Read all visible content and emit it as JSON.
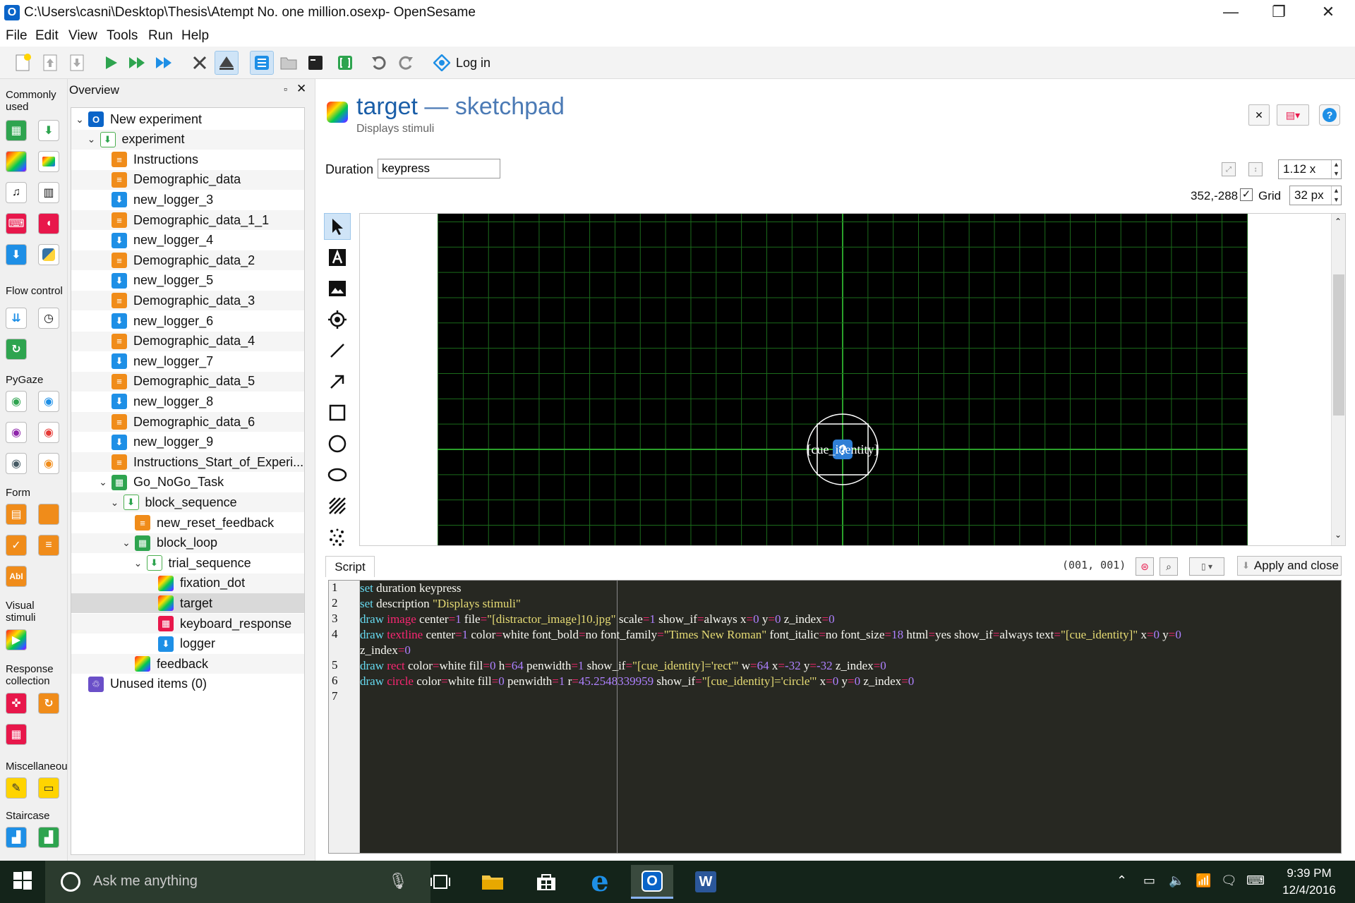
{
  "window": {
    "title": "C:\\Users\\casni\\Desktop\\Thesis\\Atempt No. one million.osexp- OpenSesame",
    "app_icon": "O",
    "minimize": "—",
    "maximize": "❐",
    "close": "✕"
  },
  "menu": [
    "File",
    "Edit",
    "View",
    "Tools",
    "Run",
    "Help"
  ],
  "toolbar": {
    "login_label": "Log in"
  },
  "palette": {
    "sections": [
      "Commonly used",
      "Flow control",
      "PyGaze",
      "Form",
      "Visual stimuli",
      "Response collection",
      "Miscellaneou",
      "Staircase"
    ]
  },
  "overview": {
    "title": "Overview",
    "float_icon": "▫",
    "close_icon": "✕",
    "items": [
      {
        "label": "New experiment",
        "level": 0,
        "icon": "exp",
        "chev": "⌄"
      },
      {
        "label": "experiment",
        "level": 1,
        "icon": "seq",
        "chev": "⌄"
      },
      {
        "label": "Instructions",
        "level": 2,
        "icon": "orange",
        "chev": ""
      },
      {
        "label": "Demographic_data",
        "level": 2,
        "icon": "orange",
        "chev": ""
      },
      {
        "label": "new_logger_3",
        "level": 2,
        "icon": "blue",
        "chev": ""
      },
      {
        "label": "Demographic_data_1_1",
        "level": 2,
        "icon": "orange",
        "chev": ""
      },
      {
        "label": "new_logger_4",
        "level": 2,
        "icon": "blue",
        "chev": ""
      },
      {
        "label": "Demographic_data_2",
        "level": 2,
        "icon": "orange",
        "chev": ""
      },
      {
        "label": "new_logger_5",
        "level": 2,
        "icon": "blue",
        "chev": ""
      },
      {
        "label": "Demographic_data_3",
        "level": 2,
        "icon": "orange",
        "chev": ""
      },
      {
        "label": "new_logger_6",
        "level": 2,
        "icon": "blue",
        "chev": ""
      },
      {
        "label": "Demographic_data_4",
        "level": 2,
        "icon": "orange",
        "chev": ""
      },
      {
        "label": "new_logger_7",
        "level": 2,
        "icon": "blue",
        "chev": ""
      },
      {
        "label": "Demographic_data_5",
        "level": 2,
        "icon": "orange",
        "chev": ""
      },
      {
        "label": "new_logger_8",
        "level": 2,
        "icon": "blue",
        "chev": ""
      },
      {
        "label": "Demographic_data_6",
        "level": 2,
        "icon": "orange",
        "chev": ""
      },
      {
        "label": "new_logger_9",
        "level": 2,
        "icon": "blue",
        "chev": ""
      },
      {
        "label": "Instructions_Start_of_Experi...",
        "level": 2,
        "icon": "orange",
        "chev": ""
      },
      {
        "label": "Go_NoGo_Task",
        "level": 2,
        "icon": "green",
        "chev": "⌄"
      },
      {
        "label": "block_sequence",
        "level": 3,
        "icon": "seq",
        "chev": "⌄"
      },
      {
        "label": "new_reset_feedback",
        "level": 4,
        "icon": "orange",
        "chev": ""
      },
      {
        "label": "block_loop",
        "level": 4,
        "icon": "green",
        "chev": "⌄"
      },
      {
        "label": "trial_sequence",
        "level": 5,
        "icon": "seq",
        "chev": "⌄"
      },
      {
        "label": "fixation_dot",
        "level": 6,
        "icon": "grad",
        "chev": ""
      },
      {
        "label": "target",
        "level": 6,
        "icon": "grad",
        "chev": "",
        "selected": true
      },
      {
        "label": "keyboard_response",
        "level": 6,
        "icon": "kb",
        "chev": ""
      },
      {
        "label": "logger",
        "level": 6,
        "icon": "blue",
        "chev": ""
      },
      {
        "label": "feedback",
        "level": 4,
        "icon": "grad",
        "chev": ""
      },
      {
        "label": "Unused items (0)",
        "level": 0,
        "icon": "unused",
        "chev": ""
      }
    ]
  },
  "item": {
    "name": "target",
    "sep": " — ",
    "type": "sketchpad",
    "description": "Displays stimuli"
  },
  "controls": {
    "duration_label": "Duration",
    "duration_value": "keypress",
    "zoom": "1.12 x",
    "coords": "352,-288",
    "grid_label": "Grid",
    "grid_checked": "✓",
    "grid_size": "32 px"
  },
  "canvas": {
    "element_text": "[cue_identity]",
    "placeholder_icon": "?",
    "grid_color": "#1b6b1b",
    "axis_color": "#2aa02a"
  },
  "script": {
    "tab_label": "Script",
    "cursor_pos": "(001, 001)",
    "apply_label": "Apply and close",
    "line_numbers": [
      "1",
      "2",
      "3",
      "4",
      "",
      "5",
      "6",
      "7"
    ]
  },
  "taskbar": {
    "search_placeholder": "Ask me anything",
    "time": "9:39 PM",
    "date": "12/4/2016"
  }
}
